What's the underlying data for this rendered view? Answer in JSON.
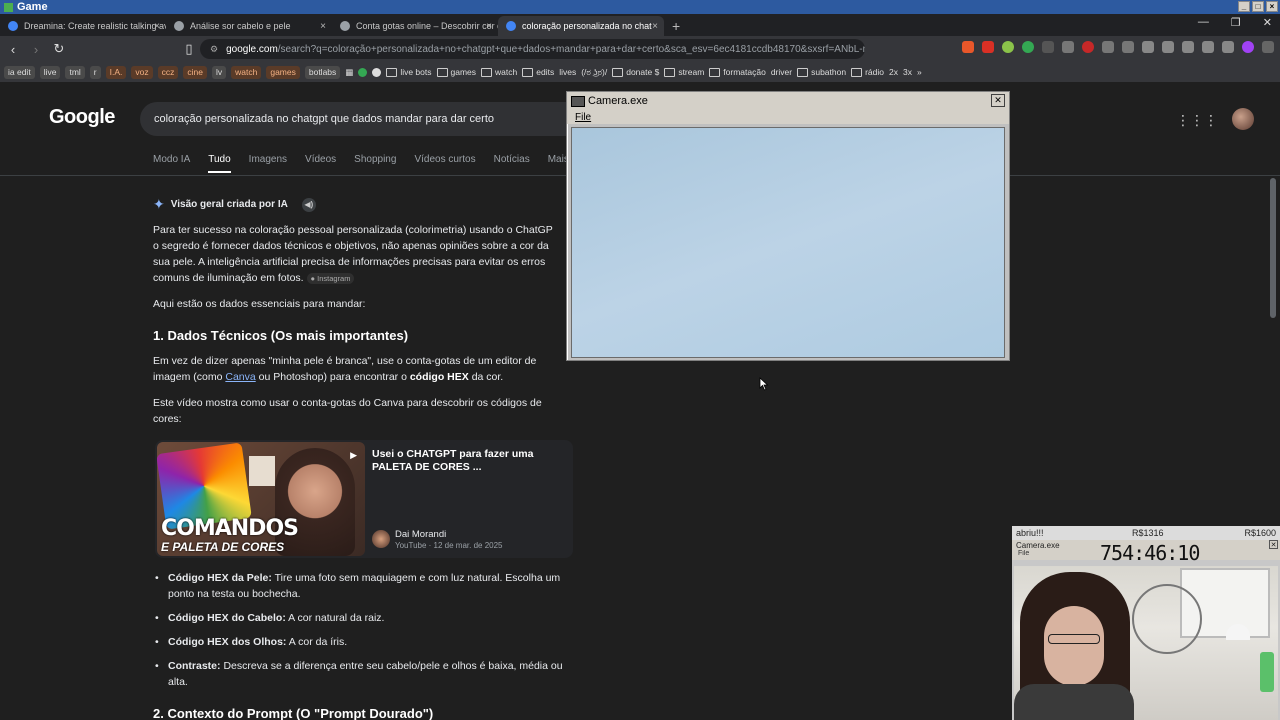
{
  "os": {
    "title": "Game"
  },
  "tabs": [
    {
      "label": "Dreamina: Create realistic talking ava",
      "color": "#4285f4"
    },
    {
      "label": "Análise sor cabelo e pele",
      "color": "#9aa0a6"
    },
    {
      "label": "Conta gotas online – Descobrir cor d",
      "color": "#9aa0a6"
    },
    {
      "label": "coloração personalizada no chat",
      "color": "#4285f4",
      "active": true
    }
  ],
  "address": {
    "host": "google.com",
    "path": "/search?q=coloração+personalizada+no+chatgpt+que+dados+mandar+para+dar+certo&sca_esv=6ec4181ccdb48170&sxsrf=ANbL-n..."
  },
  "bookmarks": {
    "tags": [
      "ia edit",
      "live",
      "tml",
      "r",
      "I.A.",
      "voz",
      "ccz",
      "cine",
      "lv",
      "watch",
      "games",
      "botlabs"
    ],
    "folders": [
      "live bots",
      "games",
      "watch",
      "edits",
      "lives",
      "(/ಠ ͜ʖಠ)/",
      "donate $",
      "stream",
      "formatação",
      "driver",
      "subathon",
      "rádio",
      "2x",
      "3x"
    ]
  },
  "search": {
    "logo": "Google",
    "query": "coloração personalizada no chatgpt que dados mandar para dar certo",
    "nav": [
      "Modo IA",
      "Tudo",
      "Imagens",
      "Vídeos",
      "Shopping",
      "Vídeos curtos",
      "Notícias",
      "Mais"
    ]
  },
  "overview": {
    "title": "Visão geral criada por IA",
    "intro_1": "Para ter sucesso na coloração pessoal personalizada (colorimetria) usando o ChatGP",
    "intro_2": "o segredo é fornecer dados técnicos e objetivos, não apenas opiniões sobre a cor da",
    "intro_3": "sua pele. A inteligência artificial precisa de informações precisas para evitar os erros",
    "intro_4": "comuns de iluminação em fotos.",
    "source_badge": "Instagram",
    "lead": "Aqui estão os dados essenciais para mandar:",
    "h1": "1. Dados Técnicos (Os mais importantes)",
    "p1_a": "Em vez de dizer apenas \"minha pele é branca\", use o conta-gotas de um editor de",
    "p1_b": "imagem (como",
    "p1_link": "Canva",
    "p1_c": "ou Photoshop) para encontrar o",
    "p1_bold": "código HEX",
    "p1_d": "da cor.",
    "p2": "Este vídeo mostra como usar o conta-gotas do Canva para descobrir os códigos de cores:",
    "video": {
      "title": "Usei o CHATGPT para fazer uma PALETA DE CORES ...",
      "thumb_caption_1": "COMANDOS",
      "thumb_caption_2": "E PALETA DE CORES",
      "author": "Dai Morandi",
      "meta": "YouTube · 12 de mar. de 2025"
    },
    "bullets": [
      {
        "label": "Código HEX da Pele:",
        "text": "Tire uma foto sem maquiagem e com luz natural. Escolha um ponto na testa ou bochecha."
      },
      {
        "label": "Código HEX do Cabelo:",
        "text": "A cor natural da raiz."
      },
      {
        "label": "Código HEX dos Olhos:",
        "text": "A cor da íris."
      },
      {
        "label": "Contraste:",
        "text": "Descreva se a diferença entre seu cabelo/pele e olhos é baixa, média ou alta."
      }
    ],
    "h2": "2. Contexto do Prompt (O \"Prompt Dourado\")"
  },
  "camera_window": {
    "title": "Camera.exe",
    "menu_file": "File"
  },
  "overlay": {
    "left_label": "abriu!!!",
    "mid_label": "R$1316",
    "right_label": "R$1600",
    "sub_title": "Camera.exe",
    "timer": "754:46:10",
    "menu": "File"
  }
}
